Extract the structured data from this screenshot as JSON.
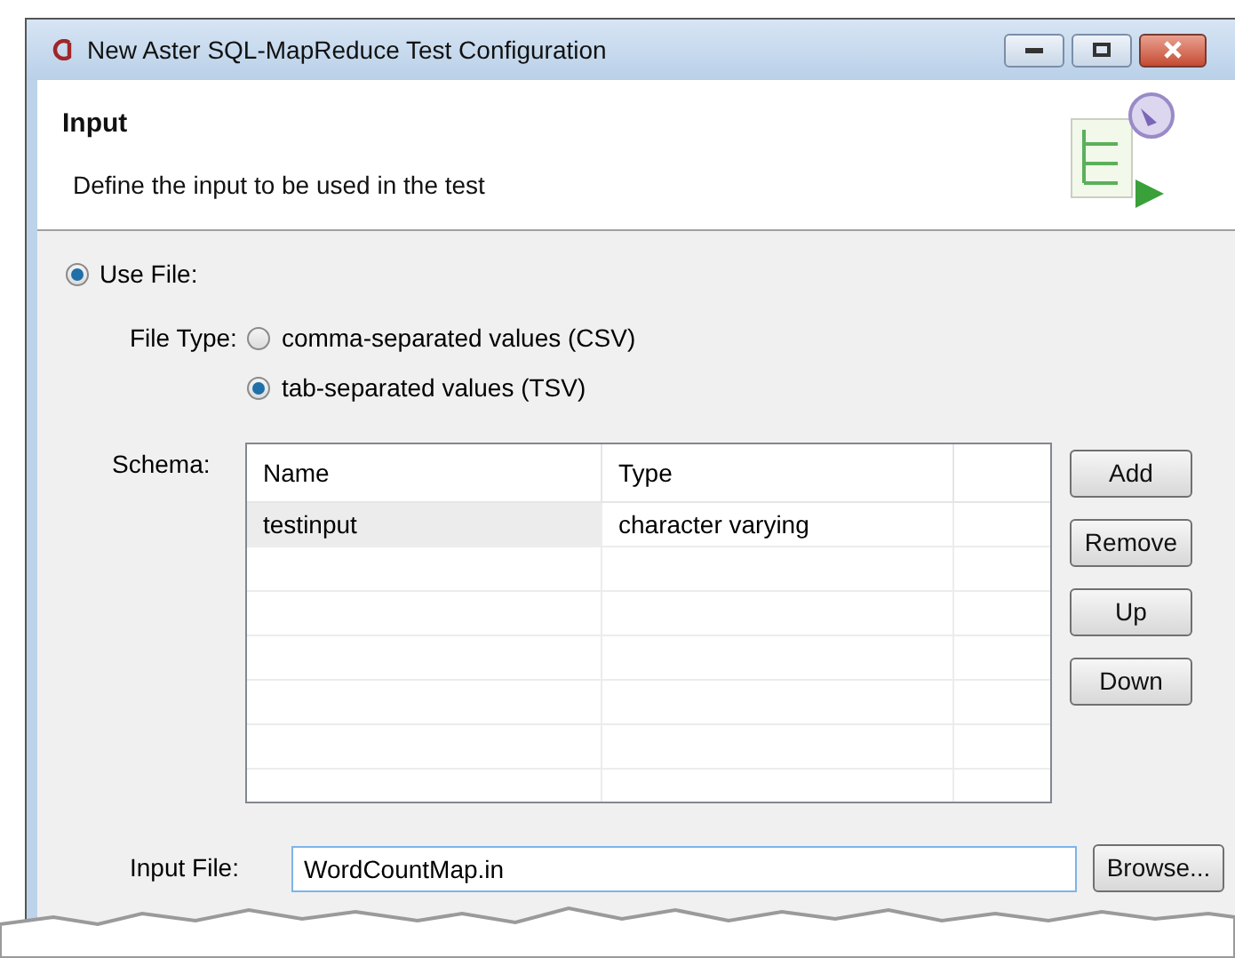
{
  "window": {
    "title": "New Aster SQL-MapReduce Test Configuration"
  },
  "header": {
    "title": "Input",
    "description": "Define the input to be used in the test"
  },
  "source": {
    "label": "Use File:",
    "selected": true
  },
  "file_type": {
    "label": "File Type:",
    "options": [
      {
        "label": "comma-separated values (CSV)",
        "selected": false
      },
      {
        "label": "tab-separated values (TSV)",
        "selected": true
      }
    ]
  },
  "schema": {
    "label": "Schema:",
    "columns": [
      "Name",
      "Type"
    ],
    "rows": [
      {
        "cells": [
          "testinput",
          "character varying"
        ],
        "selected": true
      }
    ],
    "buttons": [
      "Add",
      "Remove",
      "Up",
      "Down"
    ]
  },
  "input_file": {
    "label": "Input File:",
    "value": "WordCountMap.in",
    "button": "Browse..."
  }
}
